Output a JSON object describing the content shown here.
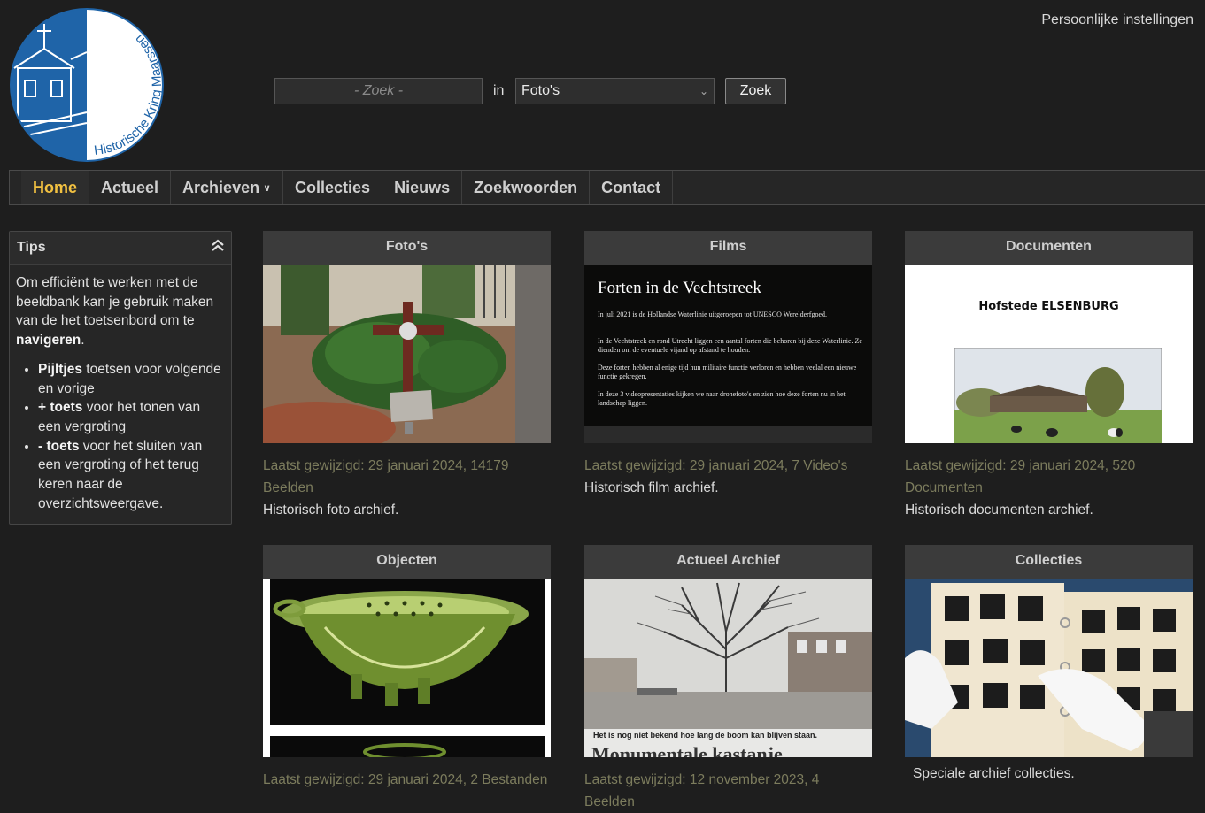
{
  "header": {
    "logo_text": "Historische Kring Maarssen",
    "personal_settings": "Persoonlijke instellingen",
    "search": {
      "placeholder": "- Zoek -",
      "in_label": "in",
      "scope": "Foto's",
      "button": "Zoek"
    }
  },
  "nav": {
    "items": [
      {
        "label": "Home"
      },
      {
        "label": "Actueel"
      },
      {
        "label": "Archieven"
      },
      {
        "label": "Collecties"
      },
      {
        "label": "Nieuws"
      },
      {
        "label": "Zoekwoorden"
      },
      {
        "label": "Contact"
      }
    ]
  },
  "tips": {
    "title": "Tips",
    "intro_pre": "Om efficiënt te werken met de beeldbank kan je gebruik maken van de het toetsenbord om te ",
    "intro_bold": "navigeren",
    "intro_post": ".",
    "items": [
      {
        "bold": "Pijltjes",
        "text": " toetsen voor volgende en vorige"
      },
      {
        "bold": "+ toets",
        "text": " voor het tonen van een vergroting"
      },
      {
        "bold": "- toets",
        "text": " voor het sluiten van een vergroting of het terug keren naar de overzichtsweergave."
      }
    ]
  },
  "cards": [
    {
      "title": "Foto's",
      "meta": "Laatst gewijzigd: 29 januari 2024, 14179 Beelden",
      "desc": "Historisch foto archief."
    },
    {
      "title": "Films",
      "meta": "Laatst gewijzigd: 29 januari 2024, 7 Video's",
      "desc": "Historisch film archief.",
      "image_text": {
        "title": "Forten in de Vechtstreek",
        "lines": [
          "In juli 2021 is de Hollandse Waterlinie uitgeroepen tot UNESCO Werelderfgoed.",
          "In de Vechtstreek en rond Utrecht liggen een aantal forten die behoren bij deze Waterlinie. Ze dienden om de eventuele vijand op afstand te houden.",
          "Deze forten hebben al enige tijd hun militaire functie verloren en hebben veelal een nieuwe functie gekregen.",
          "In deze 3 videopresentaties kijken we naar dronefoto's en zien hoe deze forten nu in het landschap liggen."
        ]
      }
    },
    {
      "title": "Documenten",
      "meta": "Laatst gewijzigd: 29 januari 2024, 520 Documenten",
      "desc": "Historisch documenten archief.",
      "image_text": {
        "title": "Hofstede ELSENBURG"
      }
    },
    {
      "title": "Objecten",
      "meta": "Laatst gewijzigd: 29 januari 2024, 2 Bestanden",
      "desc": ""
    },
    {
      "title": "Actueel Archief",
      "meta": "Laatst gewijzigd: 12 november 2023, 4 Beelden",
      "desc": "",
      "image_text": {
        "caption": "Het is nog niet bekend hoe lang de boom kan blijven staan.",
        "headline": "Monumentale kastanje"
      }
    },
    {
      "title": "Collecties",
      "meta": "",
      "desc": "Speciale archief collecties."
    }
  ],
  "colors": {
    "background": "#1e1e1e",
    "active_nav": "#f2c141",
    "meta_text": "#7c7c5d",
    "logo_blue": "#1f64a8"
  }
}
